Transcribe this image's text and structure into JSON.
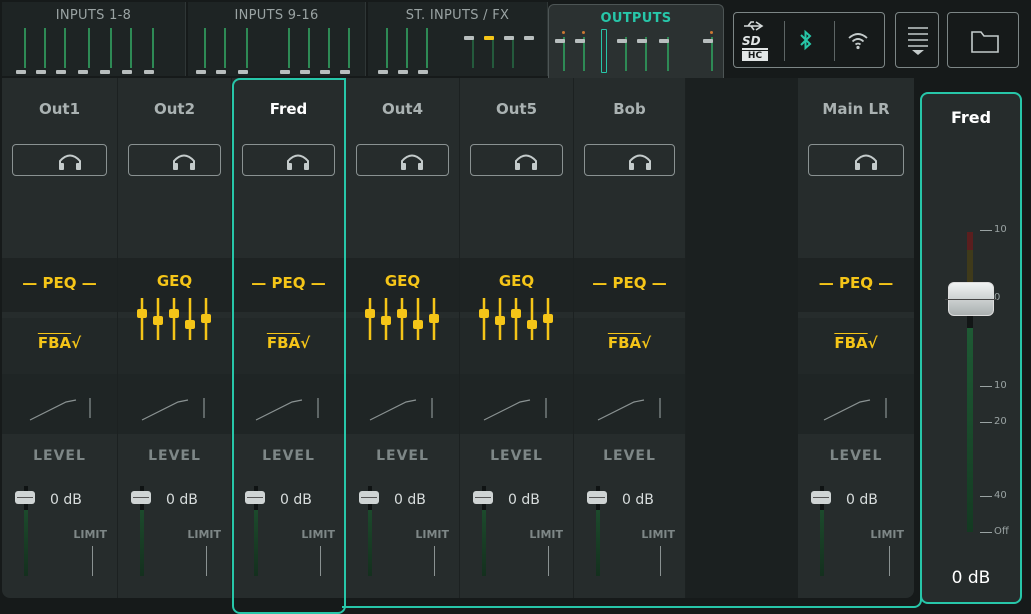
{
  "banks": [
    {
      "label": "INPUTS 1-8",
      "active": false
    },
    {
      "label": "INPUTS 9-16",
      "active": false
    },
    {
      "label": "ST. INPUTS / FX",
      "active": false
    },
    {
      "label": "OUTPUTS",
      "active": true
    }
  ],
  "toolbar": {
    "icons": [
      "usb-icon",
      "sdhc-icon",
      "bluetooth-icon",
      "wifi-icon",
      "menu-icon",
      "folder-icon"
    ],
    "sd_label": "SD",
    "hc_label": "HC"
  },
  "strips": [
    {
      "name": "Out1",
      "eq": "PEQ",
      "eq_type": "peq",
      "fba": "FBA",
      "level_label": "LEVEL",
      "level": "0 dB",
      "limit": "LIMIT"
    },
    {
      "name": "Out2",
      "eq": "GEQ",
      "eq_type": "geq",
      "level_label": "LEVEL",
      "level": "0 dB",
      "limit": "LIMIT"
    },
    {
      "name": "Fred",
      "eq": "PEQ",
      "eq_type": "peq",
      "fba": "FBA",
      "level_label": "LEVEL",
      "level": "0 dB",
      "limit": "LIMIT",
      "selected": true
    },
    {
      "name": "Out4",
      "eq": "GEQ",
      "eq_type": "geq",
      "level_label": "LEVEL",
      "level": "0 dB",
      "limit": "LIMIT"
    },
    {
      "name": "Out5",
      "eq": "GEQ",
      "eq_type": "geq",
      "level_label": "LEVEL",
      "level": "0 dB",
      "limit": "LIMIT"
    },
    {
      "name": "Bob",
      "eq": "PEQ",
      "eq_type": "peq",
      "fba": "FBA",
      "level_label": "LEVEL",
      "level": "0 dB",
      "limit": "LIMIT"
    },
    {
      "name": "Main LR",
      "eq": "PEQ",
      "eq_type": "peq",
      "fba": "FBA",
      "level_label": "LEVEL",
      "level": "0 dB",
      "limit": "LIMIT"
    }
  ],
  "selected_fader": {
    "name": "Fred",
    "level": "0 dB",
    "scale": [
      "10",
      "0",
      "10",
      "20",
      "40",
      "Off"
    ]
  },
  "colors": {
    "accent": "#27c6a9",
    "eq": "#f5c518",
    "background": "#161a1a",
    "panel": "#262c2c"
  }
}
